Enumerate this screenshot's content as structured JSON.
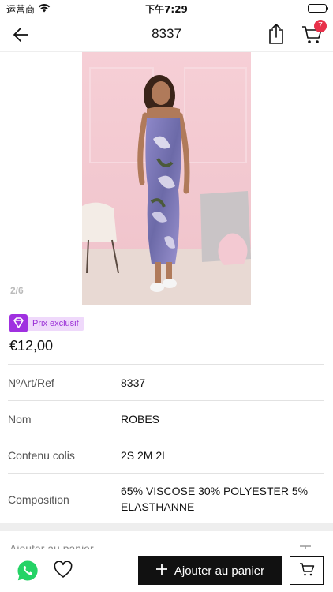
{
  "status_bar": {
    "carrier": "运营商",
    "time": "下午7:29",
    "battery_level": 1.0
  },
  "nav": {
    "title": "8337",
    "cart_count": "7"
  },
  "gallery": {
    "pager": "2/6"
  },
  "product": {
    "exclusive_label": "Prix exclusif",
    "price": "€12,00",
    "specs": [
      {
        "label": "NºArt/Ref",
        "value": "8337"
      },
      {
        "label": "Nom",
        "value": "ROBES"
      },
      {
        "label": "Contenu colis",
        "value": "2S 2M 2L"
      },
      {
        "label": "Composition",
        "value": "65% VISCOSE 30% POLYESTER 5% ELASTHANNE"
      }
    ]
  },
  "partial_row": {
    "label": "Ajouter au panier"
  },
  "bottom_bar": {
    "add_to_cart_label": "Ajouter au panier"
  },
  "colors": {
    "accent": "#e8314a",
    "exclusive": "#a030e0",
    "whatsapp": "#25d366"
  }
}
